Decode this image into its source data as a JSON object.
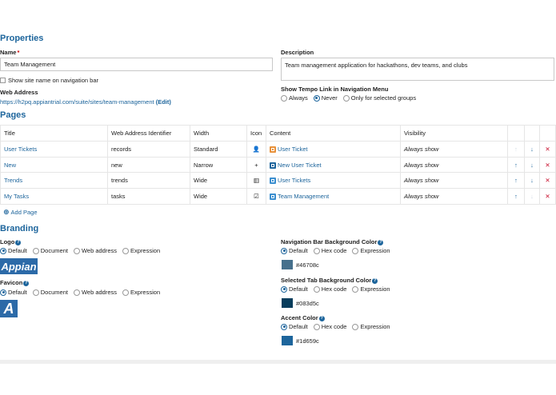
{
  "properties": {
    "title": "Properties",
    "name_label": "Name",
    "name_required": "*",
    "name_value": "Team Management",
    "show_site_name_label": "Show site name on navigation bar",
    "web_address_label": "Web Address",
    "web_address_url": "https://h2pq.appiantrial.com/suite/sites/team-management",
    "edit_label": "(Edit)",
    "description_label": "Description",
    "description_value": "Team management application for hackathons, dev teams, and clubs",
    "tempo_link_label": "Show Tempo Link in Navigation Menu",
    "tempo_options": [
      "Always",
      "Never",
      "Only for selected groups"
    ],
    "tempo_selected": "Never"
  },
  "pages": {
    "title": "Pages",
    "columns": [
      "Title",
      "Web Address Identifier",
      "Width",
      "Icon",
      "Content",
      "Visibility"
    ],
    "rows": [
      {
        "title": "User Tickets",
        "identifier": "records",
        "width": "Standard",
        "icon": "user-icon",
        "icon_glyph": "👤",
        "content_type": "record",
        "content": "User Ticket",
        "visibility": "Always show",
        "up_enabled": false,
        "down_enabled": true
      },
      {
        "title": "New",
        "identifier": "new",
        "width": "Narrow",
        "icon": "plus-icon",
        "icon_glyph": "+",
        "content_type": "action",
        "content": "New User Ticket",
        "visibility": "Always show",
        "up_enabled": true,
        "down_enabled": true
      },
      {
        "title": "Trends",
        "identifier": "trends",
        "width": "Wide",
        "icon": "bar-chart-icon",
        "icon_glyph": "▥",
        "content_type": "report",
        "content": "User Tickets",
        "visibility": "Always show",
        "up_enabled": true,
        "down_enabled": true
      },
      {
        "title": "My Tasks",
        "identifier": "tasks",
        "width": "Wide",
        "icon": "checkbox-icon",
        "icon_glyph": "☑",
        "content_type": "report",
        "content": "Team Management",
        "visibility": "Always show",
        "up_enabled": true,
        "down_enabled": false
      }
    ],
    "add_page_label": "Add Page"
  },
  "branding": {
    "title": "Branding",
    "logo_label": "Logo",
    "favicon_label": "Favicon",
    "source_options": [
      "Default",
      "Document",
      "Web address",
      "Expression"
    ],
    "logo_selected": "Default",
    "favicon_selected": "Default",
    "logo_text": "Appian",
    "favicon_text": "A",
    "nav_bg_label": "Navigation Bar Background Color",
    "selected_tab_label": "Selected Tab Background Color",
    "accent_label": "Accent Color",
    "color_options": [
      "Default",
      "Hex code",
      "Expression"
    ],
    "nav_bg_selected": "Default",
    "selected_tab_selected": "Default",
    "accent_selected": "Default",
    "nav_bg_color": "#46708c",
    "selected_tab_color": "#083d5c",
    "accent_color": "#1d659c"
  }
}
